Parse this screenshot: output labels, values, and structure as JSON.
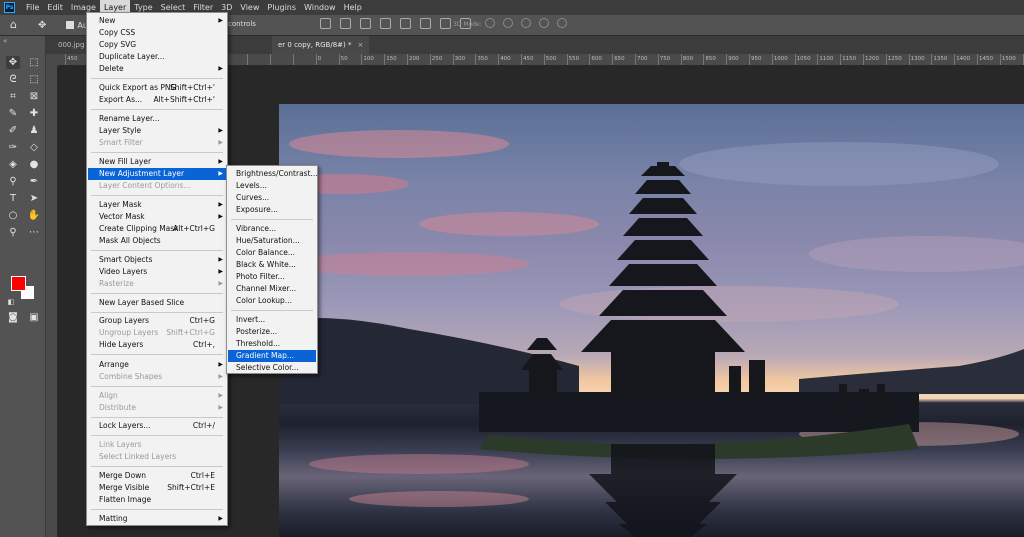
{
  "app": {
    "logo_text": "Ps"
  },
  "menubar": {
    "items": [
      "File",
      "Edit",
      "Image",
      "Layer",
      "Type",
      "Select",
      "Filter",
      "3D",
      "View",
      "Plugins",
      "Window",
      "Help"
    ],
    "active": "Layer"
  },
  "options": {
    "auto_label": "Au",
    "controls_label": "controls",
    "mode_3d_label": "3D Mode:"
  },
  "tabs": {
    "tab1": "000.jpg @",
    "tab2": "er 0 copy, RGB/8#) *",
    "close_glyph": "×"
  },
  "ruler": {
    "ticks": [
      "450",
      "",
      "",
      "",
      "",
      "",
      "",
      "",
      "",
      "",
      "",
      "0",
      "50",
      "100",
      "150",
      "200",
      "250",
      "300",
      "350",
      "400",
      "450",
      "500",
      "550",
      "600",
      "650",
      "700",
      "750",
      "800",
      "850",
      "900",
      "950",
      "1000",
      "1050",
      "1100",
      "1150",
      "1200",
      "1250",
      "1300",
      "1350",
      "1400",
      "1450",
      "1500",
      "1550",
      "1600"
    ]
  },
  "colors": {
    "foreground": "#ff0000",
    "background": "#ffffff",
    "menu_highlight": "#0a64d6"
  },
  "layer_menu": {
    "items": [
      {
        "label": "New",
        "shortcut": "",
        "submenu": true,
        "disabled": false
      },
      {
        "label": "Copy CSS",
        "shortcut": "",
        "submenu": false,
        "disabled": false
      },
      {
        "label": "Copy SVG",
        "shortcut": "",
        "submenu": false,
        "disabled": false
      },
      {
        "label": "Duplicate Layer...",
        "shortcut": "",
        "submenu": false,
        "disabled": false
      },
      {
        "label": "Delete",
        "shortcut": "",
        "submenu": true,
        "disabled": false
      },
      {
        "label": "Quick Export as PNG",
        "shortcut": "Shift+Ctrl+'",
        "submenu": false,
        "disabled": false
      },
      {
        "label": "Export As...",
        "shortcut": "Alt+Shift+Ctrl+'",
        "submenu": false,
        "disabled": false
      },
      {
        "label": "Rename Layer...",
        "shortcut": "",
        "submenu": false,
        "disabled": false
      },
      {
        "label": "Layer Style",
        "shortcut": "",
        "submenu": true,
        "disabled": false
      },
      {
        "label": "Smart Filter",
        "shortcut": "",
        "submenu": true,
        "disabled": true
      },
      {
        "label": "New Fill Layer",
        "shortcut": "",
        "submenu": true,
        "disabled": false
      },
      {
        "label": "New Adjustment Layer",
        "shortcut": "",
        "submenu": true,
        "disabled": false
      },
      {
        "label": "Layer Content Options...",
        "shortcut": "",
        "submenu": false,
        "disabled": true
      },
      {
        "label": "Layer Mask",
        "shortcut": "",
        "submenu": true,
        "disabled": false
      },
      {
        "label": "Vector Mask",
        "shortcut": "",
        "submenu": true,
        "disabled": false
      },
      {
        "label": "Create Clipping Mask",
        "shortcut": "Alt+Ctrl+G",
        "submenu": false,
        "disabled": false
      },
      {
        "label": "Mask All Objects",
        "shortcut": "",
        "submenu": false,
        "disabled": false
      },
      {
        "label": "Smart Objects",
        "shortcut": "",
        "submenu": true,
        "disabled": false
      },
      {
        "label": "Video Layers",
        "shortcut": "",
        "submenu": true,
        "disabled": false
      },
      {
        "label": "Rasterize",
        "shortcut": "",
        "submenu": true,
        "disabled": true
      },
      {
        "label": "New Layer Based Slice",
        "shortcut": "",
        "submenu": false,
        "disabled": false
      },
      {
        "label": "Group Layers",
        "shortcut": "Ctrl+G",
        "submenu": false,
        "disabled": false
      },
      {
        "label": "Ungroup Layers",
        "shortcut": "Shift+Ctrl+G",
        "submenu": false,
        "disabled": true
      },
      {
        "label": "Hide Layers",
        "shortcut": "Ctrl+,",
        "submenu": false,
        "disabled": false
      },
      {
        "label": "Arrange",
        "shortcut": "",
        "submenu": true,
        "disabled": false
      },
      {
        "label": "Combine Shapes",
        "shortcut": "",
        "submenu": true,
        "disabled": true
      },
      {
        "label": "Align",
        "shortcut": "",
        "submenu": true,
        "disabled": true
      },
      {
        "label": "Distribute",
        "shortcut": "",
        "submenu": true,
        "disabled": true
      },
      {
        "label": "Lock Layers...",
        "shortcut": "Ctrl+/",
        "submenu": false,
        "disabled": false
      },
      {
        "label": "Link Layers",
        "shortcut": "",
        "submenu": false,
        "disabled": true
      },
      {
        "label": "Select Linked Layers",
        "shortcut": "",
        "submenu": false,
        "disabled": true
      },
      {
        "label": "Merge Down",
        "shortcut": "Ctrl+E",
        "submenu": false,
        "disabled": false
      },
      {
        "label": "Merge Visible",
        "shortcut": "Shift+Ctrl+E",
        "submenu": false,
        "disabled": false
      },
      {
        "label": "Flatten Image",
        "shortcut": "",
        "submenu": false,
        "disabled": false
      },
      {
        "label": "Matting",
        "shortcut": "",
        "submenu": true,
        "disabled": false
      }
    ],
    "highlighted": "New Adjustment Layer"
  },
  "adjustment_submenu": {
    "items": [
      "Brightness/Contrast...",
      "Levels...",
      "Curves...",
      "Exposure...",
      "Vibrance...",
      "Hue/Saturation...",
      "Color Balance...",
      "Black & White...",
      "Photo Filter...",
      "Channel Mixer...",
      "Color Lookup...",
      "Invert...",
      "Posterize...",
      "Threshold...",
      "Gradient Map...",
      "Selective Color..."
    ],
    "highlighted": "Gradient Map..."
  }
}
